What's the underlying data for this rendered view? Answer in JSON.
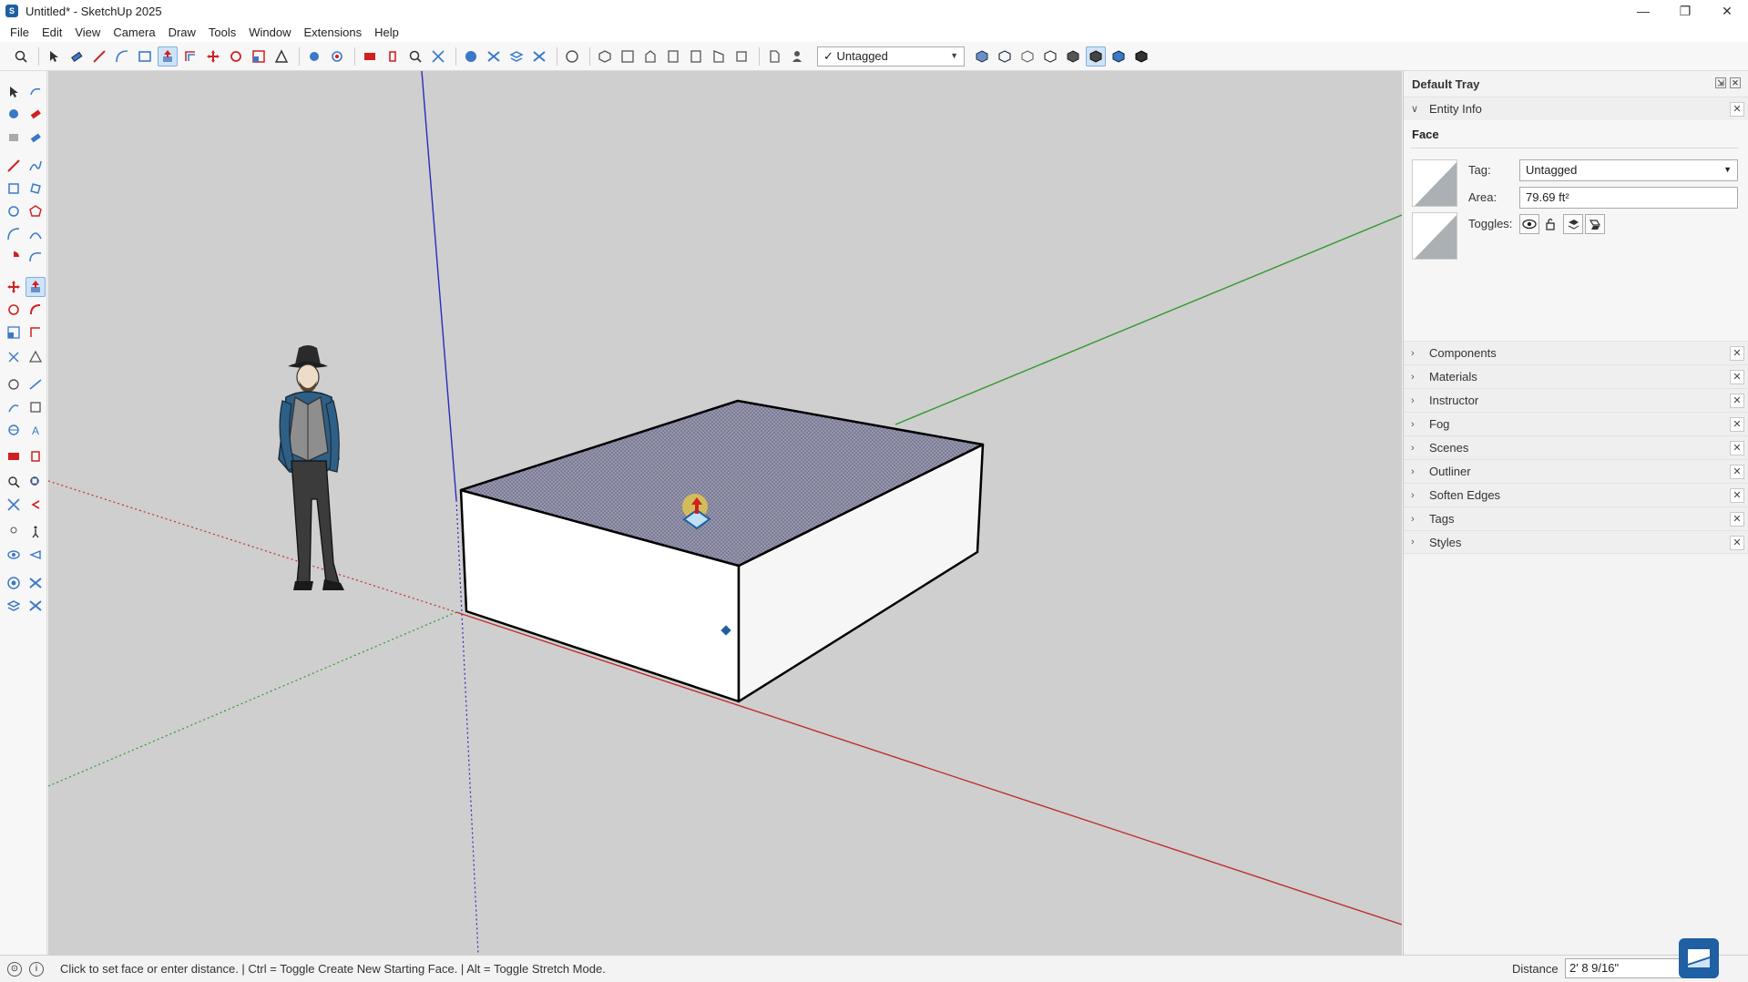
{
  "window": {
    "title": "Untitled* - SketchUp 2025",
    "minimize": "—",
    "maximize": "❐",
    "close": "✕"
  },
  "menu": [
    "File",
    "Edit",
    "View",
    "Camera",
    "Draw",
    "Tools",
    "Window",
    "Extensions",
    "Help"
  ],
  "toolbar": {
    "tag_selector_value": "✓ Untagged"
  },
  "tray": {
    "title": "Default Tray",
    "entity_info": {
      "header": "Entity Info",
      "object_type": "Face",
      "tag_label": "Tag:",
      "tag_value": "Untagged",
      "area_label": "Area:",
      "area_value": "79.69 ft²",
      "toggles_label": "Toggles:",
      "toggles": [
        "visibility-eye-icon",
        "lock-icon",
        "receive-shadows-icon",
        "cast-shadows-icon"
      ]
    },
    "panels": [
      "Components",
      "Materials",
      "Instructor",
      "Fog",
      "Scenes",
      "Outliner",
      "Soften Edges",
      "Tags",
      "Styles"
    ]
  },
  "status": {
    "hint": "Click to set face or enter distance.  |  Ctrl = Toggle Create New Starting Face.  |  Alt = Toggle Stretch Mode.",
    "distance_label": "Distance",
    "distance_value": "2' 8 9/16\""
  },
  "colors": {
    "viewport_bg": "#cfcfcf",
    "axis_red": "#c0302f",
    "axis_green": "#2e9a2e",
    "axis_blue": "#2b2bbb",
    "face_selected": "#8f8fa8",
    "accent": "#1f5fa3"
  }
}
